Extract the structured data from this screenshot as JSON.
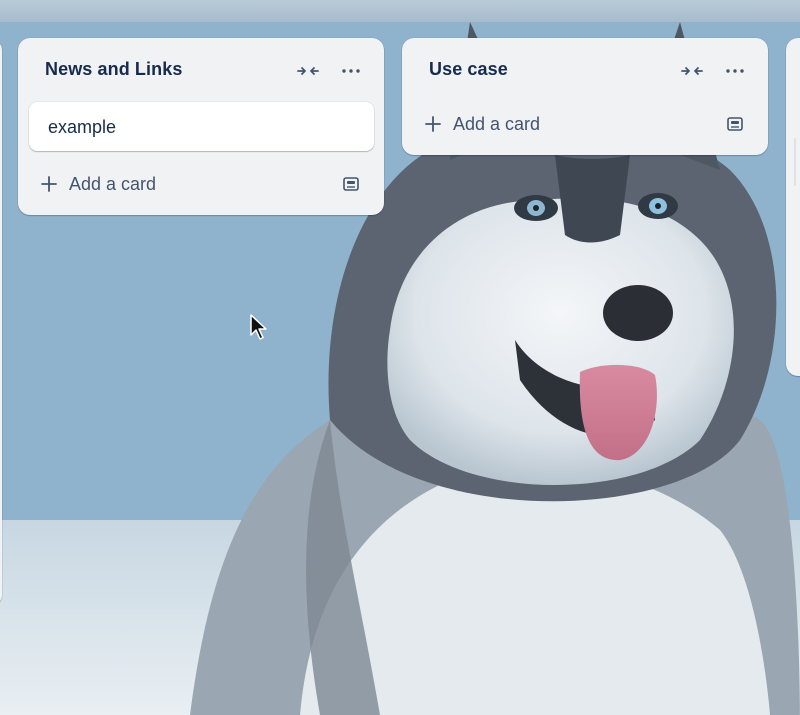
{
  "lists": [
    {
      "title": "News and Links",
      "cards": [
        "example"
      ],
      "add_card_label": "Add a card"
    },
    {
      "title": "Use case",
      "cards": [],
      "add_card_label": "Add a card"
    }
  ],
  "icons": {
    "collapse": "collapse-arrows-icon",
    "menu": "ellipsis-icon",
    "add": "plus-icon",
    "template": "card-template-icon",
    "cursor": "mouse-pointer-icon"
  },
  "colors": {
    "list_bg": "#f1f2f4",
    "card_bg": "#ffffff",
    "title_text": "#172b4d",
    "subtle_text": "#44546f"
  }
}
